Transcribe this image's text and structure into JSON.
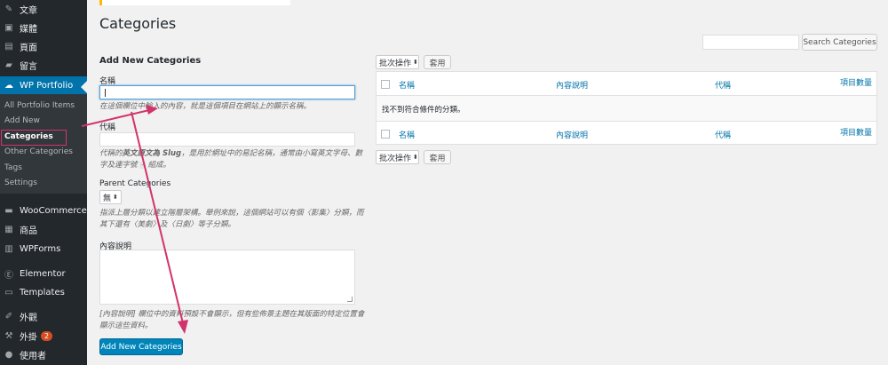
{
  "sidebar": {
    "top_items": [
      {
        "label": "文章",
        "icon": "pin-icon"
      },
      {
        "label": "媒體",
        "icon": "media-icon"
      },
      {
        "label": "頁面",
        "icon": "page-icon"
      },
      {
        "label": "留言",
        "icon": "comment-icon"
      }
    ],
    "active_item": {
      "label": "WP Portfolio",
      "icon": "portfolio-icon"
    },
    "submenu": [
      {
        "label": "All Portfolio Items"
      },
      {
        "label": "Add New"
      },
      {
        "label": "Categories"
      },
      {
        "label": "Other Categories"
      },
      {
        "label": "Tags"
      },
      {
        "label": "Settings"
      }
    ],
    "bottom_items": [
      {
        "label": "WooCommerce",
        "icon": "woocommerce-icon"
      },
      {
        "label": "商品",
        "icon": "product-icon"
      },
      {
        "label": "WPForms",
        "icon": "wpforms-icon"
      },
      {
        "label": "Elementor",
        "icon": "elementor-icon"
      },
      {
        "label": "Templates",
        "icon": "templates-icon"
      },
      {
        "label": "外觀",
        "icon": "appearance-icon"
      },
      {
        "label": "外掛",
        "icon": "plugins-icon",
        "badge": "2"
      },
      {
        "label": "使用者",
        "icon": "users-icon"
      }
    ]
  },
  "page": {
    "title": "Categories",
    "search_button": "Search Categories"
  },
  "form": {
    "heading": "Add New Categories",
    "name_label": "名稱",
    "name_desc": "在這個欄位中輸入的內容，就是這個項目在網站上的顯示名稱。",
    "slug_label": "代稱",
    "slug_desc_prefix": "代稱的",
    "slug_desc_bold": "英文原文為 Slug",
    "slug_desc_mid": "，是用於網址中的易記名稱，通常由小寫英文字母、數字及連字號",
    "slug_desc_code": "-",
    "slug_desc_suffix": "組成。",
    "parent_label": "Parent Categories",
    "parent_value": "無",
    "parent_desc": "指派上層分類以建立階層架構。舉例來說，這個網站可以有個〈影集〉分類，而其下還有〈美劇〉及〈日劇〉等子分類。",
    "description_label": "內容說明",
    "description_desc": "[內容說明] 欄位中的資料預設不會顯示，但有些佈景主題在其版面的特定位置會顯示這些資料。",
    "submit_button": "Add New Categories"
  },
  "table": {
    "bulk_action": "批次操作",
    "apply_button": "套用",
    "columns": [
      "名稱",
      "內容說明",
      "代稱",
      "項目數量"
    ],
    "empty_message": "找不到符合條件的分類。"
  },
  "colors": {
    "sidebar_bg": "#23282d",
    "active_bg": "#0073aa",
    "primary_button": "#0085ba",
    "link": "#0073aa",
    "annotation_arrow": "#d2336b"
  }
}
